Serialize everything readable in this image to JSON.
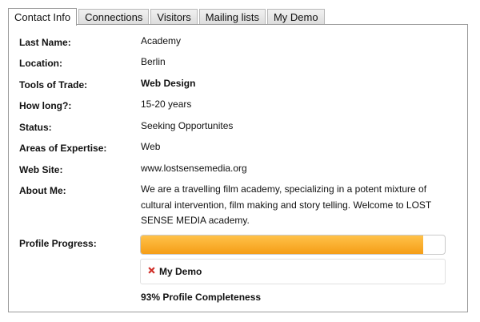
{
  "tabs": [
    {
      "label": "Contact Info",
      "active": true
    },
    {
      "label": "Connections",
      "active": false
    },
    {
      "label": "Visitors",
      "active": false
    },
    {
      "label": "Mailing lists",
      "active": false
    },
    {
      "label": "My Demo",
      "active": false
    }
  ],
  "fields": {
    "last_name": {
      "label": "Last Name:",
      "value": "Academy"
    },
    "location": {
      "label": "Location:",
      "value": "Berlin"
    },
    "tools": {
      "label": "Tools of Trade:",
      "value": "Web Design"
    },
    "how_long": {
      "label": "How long?:",
      "value": "15-20 years"
    },
    "status": {
      "label": "Status:",
      "value": "Seeking Opportunites"
    },
    "expertise": {
      "label": "Areas of Expertise:",
      "value": "Web"
    },
    "website": {
      "label": "Web Site:",
      "value": "www.lostsensemedia.org"
    },
    "about": {
      "label": "About Me:",
      "value": "We are a travelling film academy, specializing in a potent mixture of cultural intervention, film making and story telling. Welcome to LOST SENSE MEDIA academy."
    }
  },
  "profile": {
    "label": "Profile Progress:",
    "progress_fraction": 0.93,
    "item_label": "My Demo",
    "item_icon": "x-icon",
    "completeness_text": "93% Profile Completeness",
    "fill_color": "#f7a823",
    "x_color": "#d0302a"
  }
}
